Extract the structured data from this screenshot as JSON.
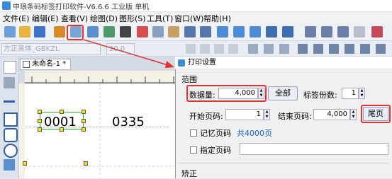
{
  "window": {
    "title": "中琅条码标签打印软件-V6.6.6 工业版 单机"
  },
  "menu": {
    "items": [
      "文件(E)",
      "编辑(E)",
      "查看(V)",
      "绘图(D)",
      "图形(S)",
      "工具(T)",
      "窗口(W)",
      "帮助(H)"
    ]
  },
  "fontbar": {
    "font_name": "方正黑体_GBKZL",
    "font_size": "20.0"
  },
  "document": {
    "tab_label": "未命名-1 *"
  },
  "canvas": {
    "barcode_values": [
      "0001",
      "0335"
    ]
  },
  "dialog": {
    "title": "打印设置",
    "section_range": "范围",
    "data_count_label": "数据量:",
    "data_count_value": "4,000",
    "all_button": "全部",
    "label_copies_label": "标签份数:",
    "label_copies_value": "1",
    "start_page_label": "开始页码:",
    "start_page_value": "1",
    "end_page_label": "结束页码:",
    "end_page_value": "4,000",
    "last_page_button": "尾页",
    "remember_page_label": "记忆页码",
    "total_pages": "共4000页",
    "specify_page_label": "指定页码",
    "section_correction": "矫正"
  },
  "colors": {
    "highlight": "#e23232",
    "accent_text": "#1565c0"
  }
}
